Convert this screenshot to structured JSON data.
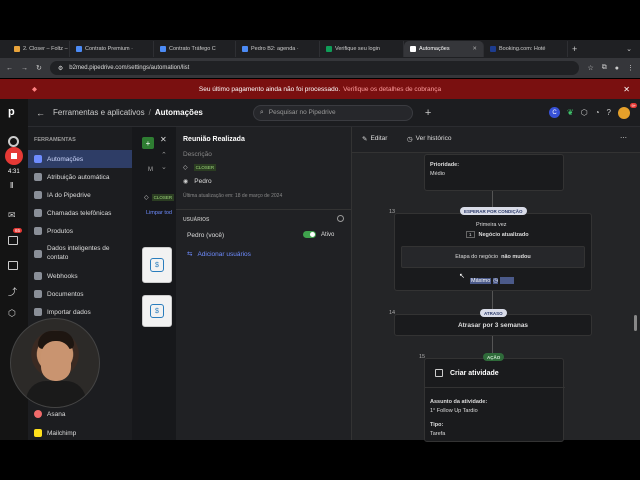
{
  "browser": {
    "tabs": [
      {
        "label": "2. Closer – Foltz –",
        "color": "#e8a33b"
      },
      {
        "label": "Contrato Premium ·",
        "color": "#4c8bf5"
      },
      {
        "label": "Contrato Tráfego C",
        "color": "#4c8bf5"
      },
      {
        "label": "Pedro B2: agenda ·",
        "color": "#4c8bf5"
      },
      {
        "label": "Verifique seu login",
        "color": "#0f9d58"
      },
      {
        "label": "Automações",
        "color": "#ffffff"
      },
      {
        "label": "Booking.com: Hoté",
        "color": "#1d3c8f"
      }
    ],
    "url": "b2med.pipedrive.com/settings/automation/list"
  },
  "banner": {
    "text": "Seu último pagamento ainda não foi processado.",
    "link": "Verifique os detalhes de cobrança"
  },
  "rail": {
    "time": "4:31",
    "badge": "65"
  },
  "header": {
    "breadcrumb_parent": "Ferramentas e aplicativos",
    "separator": "/",
    "breadcrumb_current": "Automações",
    "search_placeholder": "Pesquisar no Pipedrive",
    "notif_count": "9+"
  },
  "sidebar": {
    "section": "FERRAMENTAS",
    "items": [
      {
        "label": "Automações",
        "active": true
      },
      {
        "label": "Atribuição automática"
      },
      {
        "label": "IA do Pipedrive"
      },
      {
        "label": "Chamadas telefônicas"
      },
      {
        "label": "Produtos"
      },
      {
        "label": "Dados inteligentes de contato"
      },
      {
        "label": "Webhooks"
      },
      {
        "label": "Documentos"
      },
      {
        "label": "Importar dados"
      }
    ],
    "bottom": [
      {
        "label": "Asana"
      },
      {
        "label": "Mailchimp"
      }
    ]
  },
  "mid": {
    "tag": "CLOSER",
    "link": "Limpar tod",
    "text_m": "M"
  },
  "panel": {
    "title": "Reunião Realizada",
    "description": "Descrição",
    "tag": "CLOSER",
    "owner": "Pedro",
    "updated": "Última atualização em: 18 de março de 2024",
    "users_heading": "USUÁRIOS",
    "user_name": "Pedro (você)",
    "user_status": "Ativo",
    "add_users": "Adicionar usuários"
  },
  "canvas": {
    "edit": "Editar",
    "history": "Ver histórico",
    "top_node": {
      "label": "Prioridade:",
      "value": "Médio"
    },
    "n13": {
      "num": "13",
      "pill": "ESPERAR POR CONDIÇÃO",
      "first": "Primeira vez",
      "count": "1",
      "event": "Negócio atualizado",
      "cond_a": "Etapa do negócio",
      "cond_b": "não mudou",
      "max": "Máximo"
    },
    "n14": {
      "num": "14",
      "pill": "ATRASO",
      "text": "Atrasar por 3 semanas"
    },
    "n15": {
      "num": "15",
      "pill": "AÇÃO",
      "title": "Criar atividade",
      "f1_label": "Assunto da atividade:",
      "f1_value": "1° Follow Up Tardio",
      "f2_label": "Tipo:",
      "f2_value": "Tarefa"
    }
  }
}
